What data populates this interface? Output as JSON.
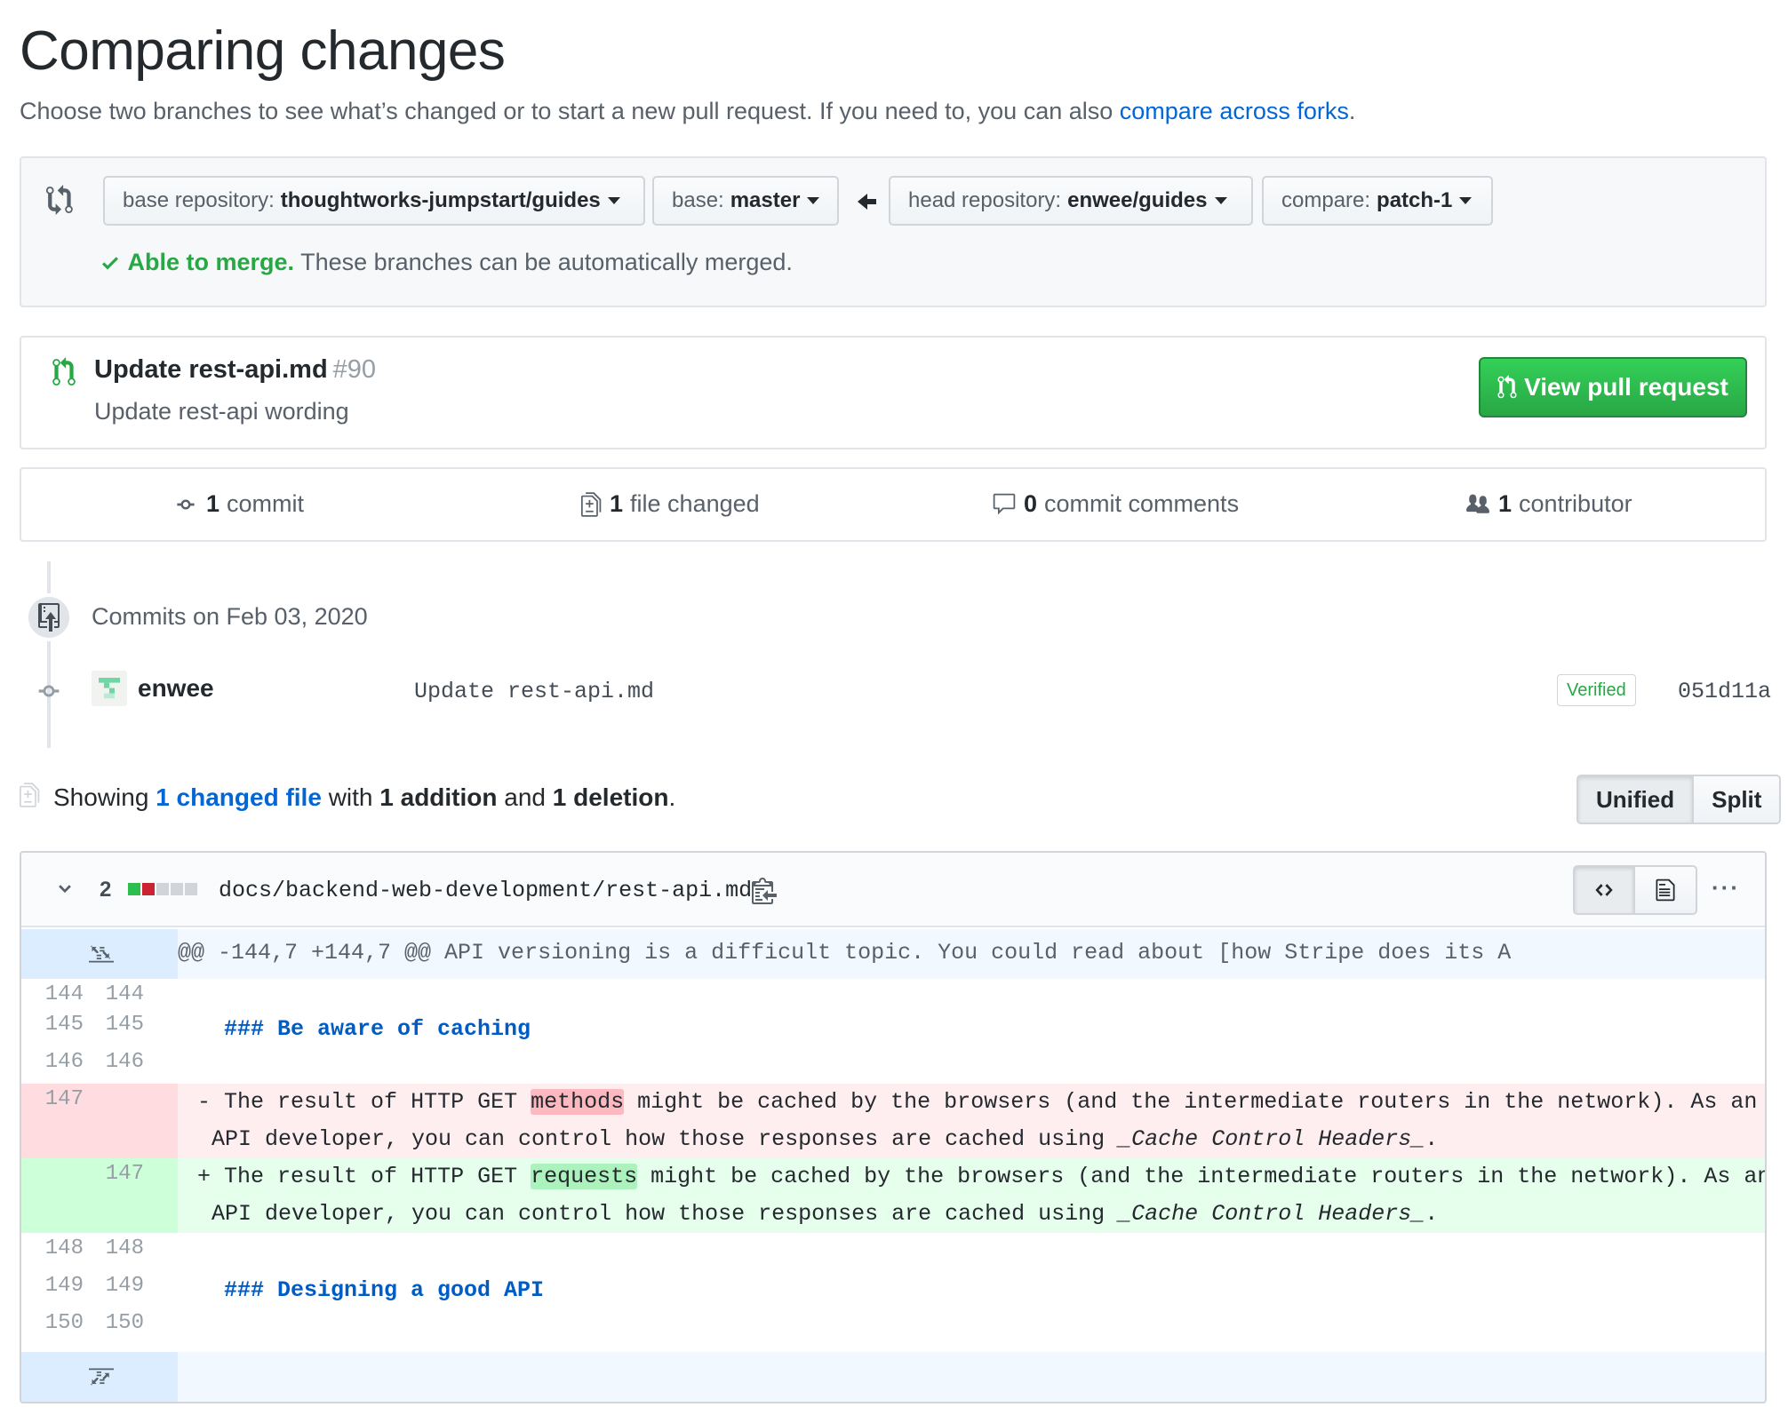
{
  "header": {
    "title": "Comparing changes",
    "subtitle_text": "Choose two branches to see what’s changed or to start a new pull request. If you need to, you can also",
    "subtitle_link": "compare across forks",
    "subtitle_end": "."
  },
  "range": {
    "base_repo_label": "base repository:",
    "base_repo_value": "thoughtworks-jumpstart/guides",
    "base_label": "base:",
    "base_value": "master",
    "head_repo_label": "head repository:",
    "head_repo_value": "enwee/guides",
    "compare_label": "compare:",
    "compare_value": "patch-1",
    "merge_status": "Able to merge.",
    "merge_text": "These branches can be automatically merged."
  },
  "pull_request": {
    "title": "Update rest-api.md",
    "number": "#90",
    "description": "Update rest-api wording",
    "button_label": "View pull request"
  },
  "numbers": {
    "commits_count": "1",
    "commits_label": "commit",
    "files_count": "1",
    "files_label": "file changed",
    "comments_count": "0",
    "comments_label": "commit comments",
    "contributors_count": "1",
    "contributors_label": "contributor"
  },
  "commits": {
    "date_heading": "Commits on Feb 03, 2020",
    "items": [
      {
        "author": "enwee",
        "message": "Update rest-api.md",
        "badge": "Verified",
        "sha": "051d11a"
      }
    ]
  },
  "showing": {
    "prefix": "Showing",
    "link": "1 changed file",
    "mid": "with",
    "additions": "1 addition",
    "and": "and",
    "deletions": "1 deletion",
    "end": "."
  },
  "view_toggle": {
    "unified": "Unified",
    "split": "Split",
    "selected": "Unified"
  },
  "file": {
    "changes": "2",
    "path": "docs/backend-web-development/rest-api.md",
    "more": "···",
    "hunk": "@@ -144,7 +144,7 @@ API versioning is a difficult topic. You could read about [how Stripe does its A",
    "lines": [
      {
        "old": "144",
        "new": "144",
        "text": ""
      },
      {
        "old": "145",
        "new": "145",
        "text": "### Be aware of caching"
      },
      {
        "old": "146",
        "new": "146",
        "text": ""
      },
      {
        "old": "147",
        "new": "",
        "sign": "-",
        "pre": "The result of HTTP GET ",
        "hl": "methods",
        "post": " might be cached by the browsers (and the intermediate routers in the network). As an",
        "line2_pre": "API developer, you can control how those responses are cached using ",
        "line2_em": "_Cache Control Headers_",
        "line2_end": "."
      },
      {
        "old": "",
        "new": "147",
        "sign": "+",
        "pre": "The result of HTTP GET ",
        "hl": "requests",
        "post": " might be cached by the browsers (and the intermediate routers in the network). As an",
        "line2_pre": "API developer, you can control how those responses are cached using ",
        "line2_em": "_Cache Control Headers_",
        "line2_end": "."
      },
      {
        "old": "148",
        "new": "148",
        "text": ""
      },
      {
        "old": "149",
        "new": "149",
        "text": "### Designing a good API"
      },
      {
        "old": "150",
        "new": "150",
        "text": ""
      }
    ]
  },
  "colors": {
    "link": "#0366d6",
    "success": "#28a745",
    "deletion_bg": "#ffeef0",
    "addition_bg": "#e6ffed",
    "hunk_bg": "#f1f8ff"
  },
  "icons": [
    "compare-arrows-icon",
    "check-icon",
    "pull-request-icon",
    "commit-icon",
    "file-diff-icon",
    "comment-icon",
    "people-icon",
    "repo-push-icon",
    "chevron-down-icon",
    "clipboard-icon",
    "code-icon",
    "file-icon",
    "kebab-horizontal-icon",
    "unfold-up-icon",
    "unfold-down-icon"
  ]
}
